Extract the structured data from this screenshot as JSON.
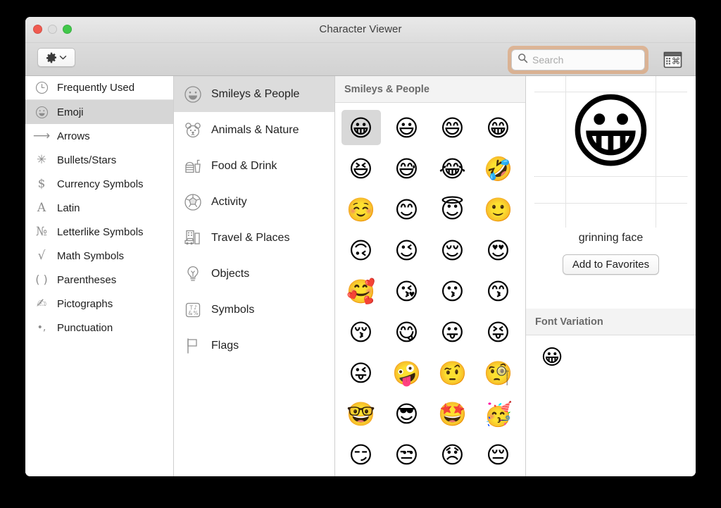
{
  "window": {
    "title": "Character Viewer",
    "controls": {
      "close": "close",
      "minimize": "minimize",
      "zoom": "zoom"
    }
  },
  "toolbar": {
    "gear_label": "gear-menu",
    "gear_chevron": "chevron-down",
    "input_source_label": "input-source-picker"
  },
  "search": {
    "value": "",
    "placeholder": "Search",
    "icon": "search-icon",
    "focus_ring_color": "#de965c"
  },
  "sidebar": {
    "items": [
      {
        "label": "Frequently Used",
        "icon": "clock-icon",
        "glyph": "◴",
        "selected": false,
        "separator": true
      },
      {
        "label": "Emoji",
        "icon": "smiley-icon",
        "glyph": "☺",
        "selected": true,
        "separator": false
      },
      {
        "label": "Arrows",
        "icon": "arrow-right-icon",
        "glyph": "⟶",
        "selected": false,
        "separator": false
      },
      {
        "label": "Bullets/Stars",
        "icon": "asterisk-icon",
        "glyph": "✳",
        "selected": false,
        "separator": false
      },
      {
        "label": "Currency Symbols",
        "icon": "dollar-icon",
        "glyph": "$",
        "selected": false,
        "separator": false
      },
      {
        "label": "Latin",
        "icon": "letter-a-icon",
        "glyph": "A",
        "selected": false,
        "separator": false
      },
      {
        "label": "Letterlike Symbols",
        "icon": "numero-icon",
        "glyph": "№",
        "selected": false,
        "separator": false
      },
      {
        "label": "Math Symbols",
        "icon": "square-root-icon",
        "glyph": "√",
        "selected": false,
        "separator": false
      },
      {
        "label": "Parentheses",
        "icon": "parentheses-icon",
        "glyph": "( )",
        "selected": false,
        "separator": false
      },
      {
        "label": "Pictographs",
        "icon": "pictograph-icon",
        "glyph": "✍",
        "selected": false,
        "separator": false
      },
      {
        "label": "Punctuation",
        "icon": "punctuation-icon",
        "glyph": "•,",
        "selected": false,
        "separator": false
      }
    ]
  },
  "categories": {
    "items": [
      {
        "label": "Smileys & People",
        "icon": "smiley-category-icon",
        "selected": true
      },
      {
        "label": "Animals & Nature",
        "icon": "bear-category-icon",
        "selected": false
      },
      {
        "label": "Food & Drink",
        "icon": "burger-drink-category-icon",
        "selected": false
      },
      {
        "label": "Activity",
        "icon": "soccer-ball-category-icon",
        "selected": false
      },
      {
        "label": "Travel & Places",
        "icon": "car-building-category-icon",
        "selected": false
      },
      {
        "label": "Objects",
        "icon": "lightbulb-category-icon",
        "selected": false
      },
      {
        "label": "Symbols",
        "icon": "symbols-category-icon",
        "selected": false
      },
      {
        "label": "Flags",
        "icon": "flag-category-icon",
        "selected": false
      }
    ]
  },
  "grid": {
    "header": "Smileys & People",
    "columns": 4,
    "selected_index": 0,
    "emojis": [
      "😀",
      "😃",
      "😄",
      "😁",
      "😆",
      "😅",
      "😂",
      "🤣",
      "☺️",
      "😊",
      "😇",
      "🙂",
      "🙃",
      "😉",
      "😌",
      "😍",
      "🥰",
      "😘",
      "😗",
      "😙",
      "😚",
      "😋",
      "😛",
      "😝",
      "😜",
      "🤪",
      "🤨",
      "🧐",
      "🤓",
      "😎",
      "🤩",
      "🥳",
      "😏",
      "😒",
      "😞",
      "😔"
    ]
  },
  "preview": {
    "big_emoji": "😀",
    "character_name": "grinning face",
    "favorites_button": "Add to Favorites"
  },
  "variation": {
    "header": "Font Variation",
    "items": [
      "😀"
    ]
  }
}
